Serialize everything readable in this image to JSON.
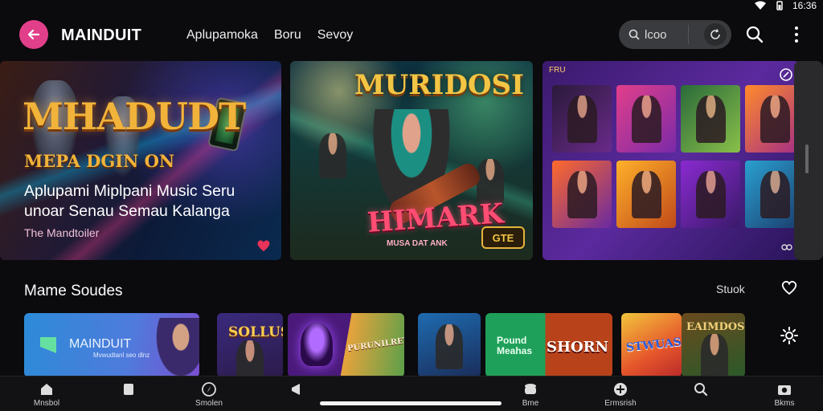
{
  "status_bar": {
    "time": "16:36"
  },
  "header": {
    "brand": "MAINDUIT",
    "nav": [
      "Aplupamoka",
      "Boru",
      "Sevoy"
    ],
    "search_pill_text": "lcoo"
  },
  "hero_cards": [
    {
      "art_title": "MHADUDT",
      "art_tagline": "MEPA DGIN ON",
      "description_line1": "Aplupami Miplpani Music Seru",
      "description_line2": "unoar Senau Semau Kalanga",
      "sub_label": "The Mandtoiler"
    },
    {
      "art_title": "MURIDOSI",
      "art_subtitle": "HIMARK",
      "art_caption": "MUSA DAT ANK",
      "badge": "GTE"
    },
    {
      "corner_label": "FRU"
    }
  ],
  "section": {
    "title": "Mame Soudes",
    "action": "Stuok"
  },
  "row_cards": [
    {
      "name": "MAINDUIT",
      "sub": "Mvwudtanl seo dlnz"
    },
    {
      "title": "SOLLUS"
    },
    {
      "title": "PURUNILRET"
    },
    {
      "title": ""
    },
    {
      "title1": "Pound",
      "title2": "Meahas",
      "title3": "SHORN"
    },
    {
      "title": "STWUAS"
    },
    {
      "title": "EAIMDOS"
    }
  ],
  "bottom_nav": [
    {
      "label": "Mnsbol",
      "icon": "home-icon"
    },
    {
      "label": "",
      "icon": "tag-icon"
    },
    {
      "label": "Smolen",
      "icon": "compass-icon"
    },
    {
      "label": "",
      "icon": "megaphone-icon"
    },
    {
      "label": "Bme",
      "icon": "stack-icon"
    },
    {
      "label": "Ermsrish",
      "icon": "plus-circle-icon"
    },
    {
      "label": "",
      "icon": "search-icon"
    },
    {
      "label": "Bkms",
      "icon": "camera-icon"
    }
  ],
  "colors": {
    "accent": "#e23f8a",
    "background": "#0b0a0d",
    "pill": "#3a3b3e"
  }
}
